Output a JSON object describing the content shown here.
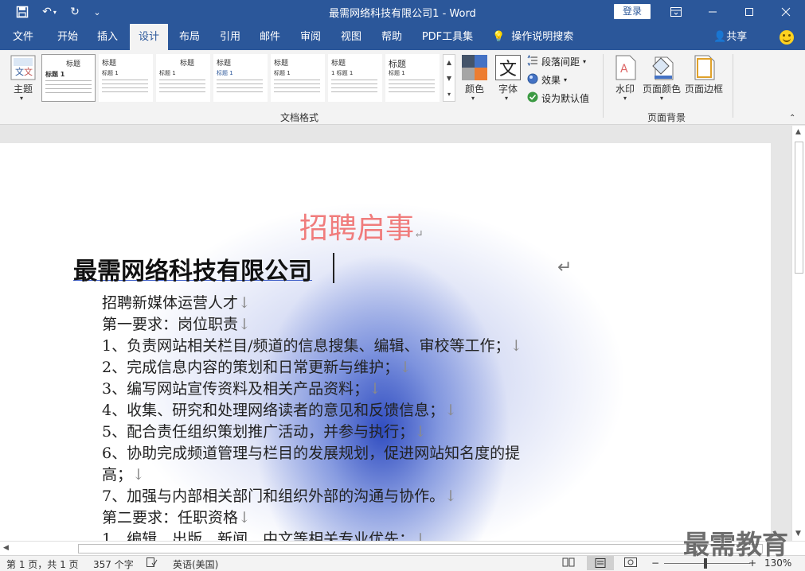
{
  "titlebar": {
    "title": "最需网络科技有限公司1  -  Word",
    "login": "登录"
  },
  "menu": {
    "tabs": [
      "文件",
      "开始",
      "插入",
      "设计",
      "布局",
      "引用",
      "邮件",
      "审阅",
      "视图",
      "帮助",
      "PDF工具集"
    ],
    "active_tab": "设计",
    "tellme": "操作说明搜索",
    "share": "共享"
  },
  "ribbon": {
    "theme_label": "主题",
    "styles": [
      {
        "title": "标题",
        "sub": "标题 1"
      },
      {
        "title": "标题",
        "sub": "标题 1"
      },
      {
        "title": "标题",
        "sub": "标题 1"
      },
      {
        "title": "标题",
        "sub": "标题 1"
      },
      {
        "title": "标题",
        "sub": "标题 1"
      },
      {
        "title": "标题",
        "sub": "1  标题 1"
      },
      {
        "title": "标题",
        "sub": "标题 1"
      }
    ],
    "colors_label": "颜色",
    "fonts_label": "字体",
    "paragraph_spacing": "段落间距",
    "effects": "效果",
    "set_default": "设为默认值",
    "group_doc_format": "文档格式",
    "watermark": "水印",
    "page_color": "页面颜色",
    "page_border": "页面边框",
    "group_page_bg": "页面背景"
  },
  "document": {
    "heading": "招聘启事",
    "company": "最需网络科技有限公司",
    "lines": [
      "招聘新媒体运营人才",
      "第一要求：岗位职责",
      "1、负责网站相关栏目/频道的信息搜集、编辑、审校等工作；",
      "2、完成信息内容的策划和日常更新与维护；",
      "3、编写网站宣传资料及相关产品资料；",
      "4、收集、研究和处理网络读者的意见和反馈信息；",
      "5、配合责任组织策划推广活动，并参与执行；",
      "6、协助完成频道管理与栏目的发展规划，促进网站知名度的提",
      "高；",
      "7、加强与内部相关部门和组织外部的沟通与协作。",
      "第二要求：任职资格",
      "1、编辑、出版、新闻、中文等相关专业优先；"
    ]
  },
  "status": {
    "page": "第 1 页，共 1 页",
    "words": "357 个字",
    "language": "英语(美国)",
    "zoom": "130%"
  },
  "watermark_text": "最需教育"
}
